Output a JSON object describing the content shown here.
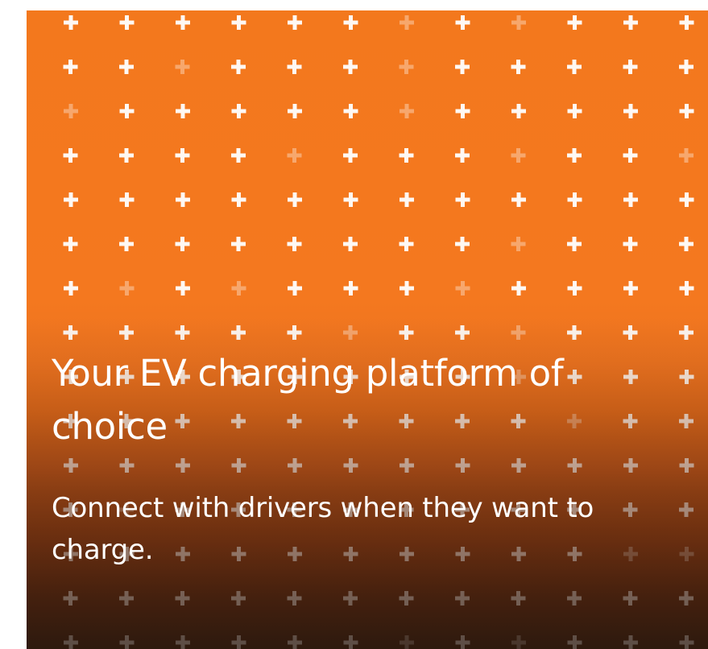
{
  "hero": {
    "headline": "Your EV charging platform of choice",
    "subline": "Connect with drivers when they want to charge."
  },
  "colors": {
    "brand_orange": "#f4781f",
    "bottom_shade": "#3b2212",
    "text": "#ffffff",
    "plus_icon": "#ffffff"
  },
  "icons": {
    "pattern_glyph": "plus-icon"
  }
}
